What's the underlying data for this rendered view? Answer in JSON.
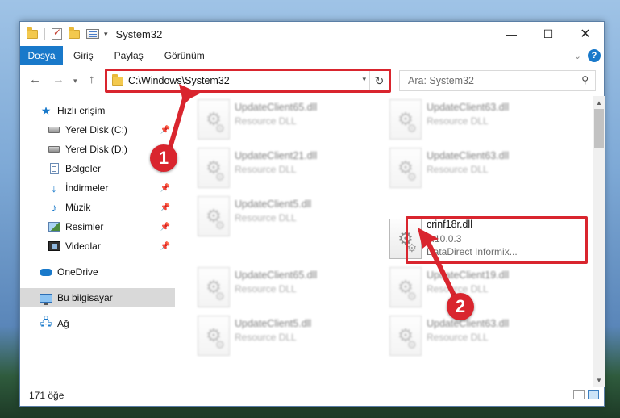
{
  "window": {
    "title": "System32",
    "controls": {
      "minimize": "—",
      "maximize": "☐",
      "close": "✕"
    }
  },
  "ribbon": {
    "file_tab": "Dosya",
    "tabs": [
      "Giriş",
      "Paylaş",
      "Görünüm"
    ],
    "help": "?"
  },
  "address": {
    "path": "C:\\Windows\\System32",
    "search_placeholder": "Ara: System32"
  },
  "nav": {
    "items": [
      {
        "label": "Hızlı erişim",
        "icon": "star-icon",
        "pinned": false
      },
      {
        "label": "Yerel Disk (C:)",
        "icon": "drive-icon",
        "pinned": true
      },
      {
        "label": "Yerel Disk (D:)",
        "icon": "drive-icon",
        "pinned": false
      },
      {
        "label": "Belgeler",
        "icon": "documents-icon",
        "pinned": true
      },
      {
        "label": "İndirmeler",
        "icon": "download-icon",
        "pinned": true
      },
      {
        "label": "Müzik",
        "icon": "music-icon",
        "pinned": true
      },
      {
        "label": "Resimler",
        "icon": "pictures-icon",
        "pinned": true
      },
      {
        "label": "Videolar",
        "icon": "videos-icon",
        "pinned": true
      },
      {
        "label": "OneDrive",
        "icon": "onedrive-icon",
        "pinned": false
      },
      {
        "label": "Bu bilgisayar",
        "icon": "this-pc-icon",
        "pinned": false,
        "selected": true
      },
      {
        "label": "Ağ",
        "icon": "network-icon",
        "pinned": false
      }
    ]
  },
  "files": [
    {
      "name": "UpdateClient65.dll",
      "sub": "Resource DLL",
      "blurred": true
    },
    {
      "name": "UpdateClient63.dll",
      "sub": "Resource DLL",
      "blurred": true
    },
    {
      "name": "UpdateClient21.dll",
      "sub": "Resource DLL",
      "blurred": true
    },
    {
      "name": "UpdateClient63.dll",
      "sub": "Resource DLL",
      "blurred": true
    },
    {
      "name": "UpdateClient5.dll",
      "sub": "Resource DLL",
      "blurred": true
    },
    {
      "name": "crinf18r.dll",
      "sub": "4.10.0.3",
      "sub2": "DataDirect Informix...",
      "blurred": false,
      "highlighted": true
    },
    {
      "name": "UpdateClient65.dll",
      "sub": "Resource DLL",
      "blurred": true
    },
    {
      "name": "UpdateClient19.dll",
      "sub": "Resource DLL",
      "blurred": true
    },
    {
      "name": "UpdateClient5.dll",
      "sub": "Resource DLL",
      "blurred": true
    },
    {
      "name": "UpdateClient63.dll",
      "sub": "Resource DLL",
      "blurred": true
    }
  ],
  "status": {
    "item_count": "171 öğe"
  },
  "callouts": [
    "1",
    "2"
  ],
  "colors": {
    "accent": "#1979ca",
    "highlight_red": "#d9252e"
  }
}
